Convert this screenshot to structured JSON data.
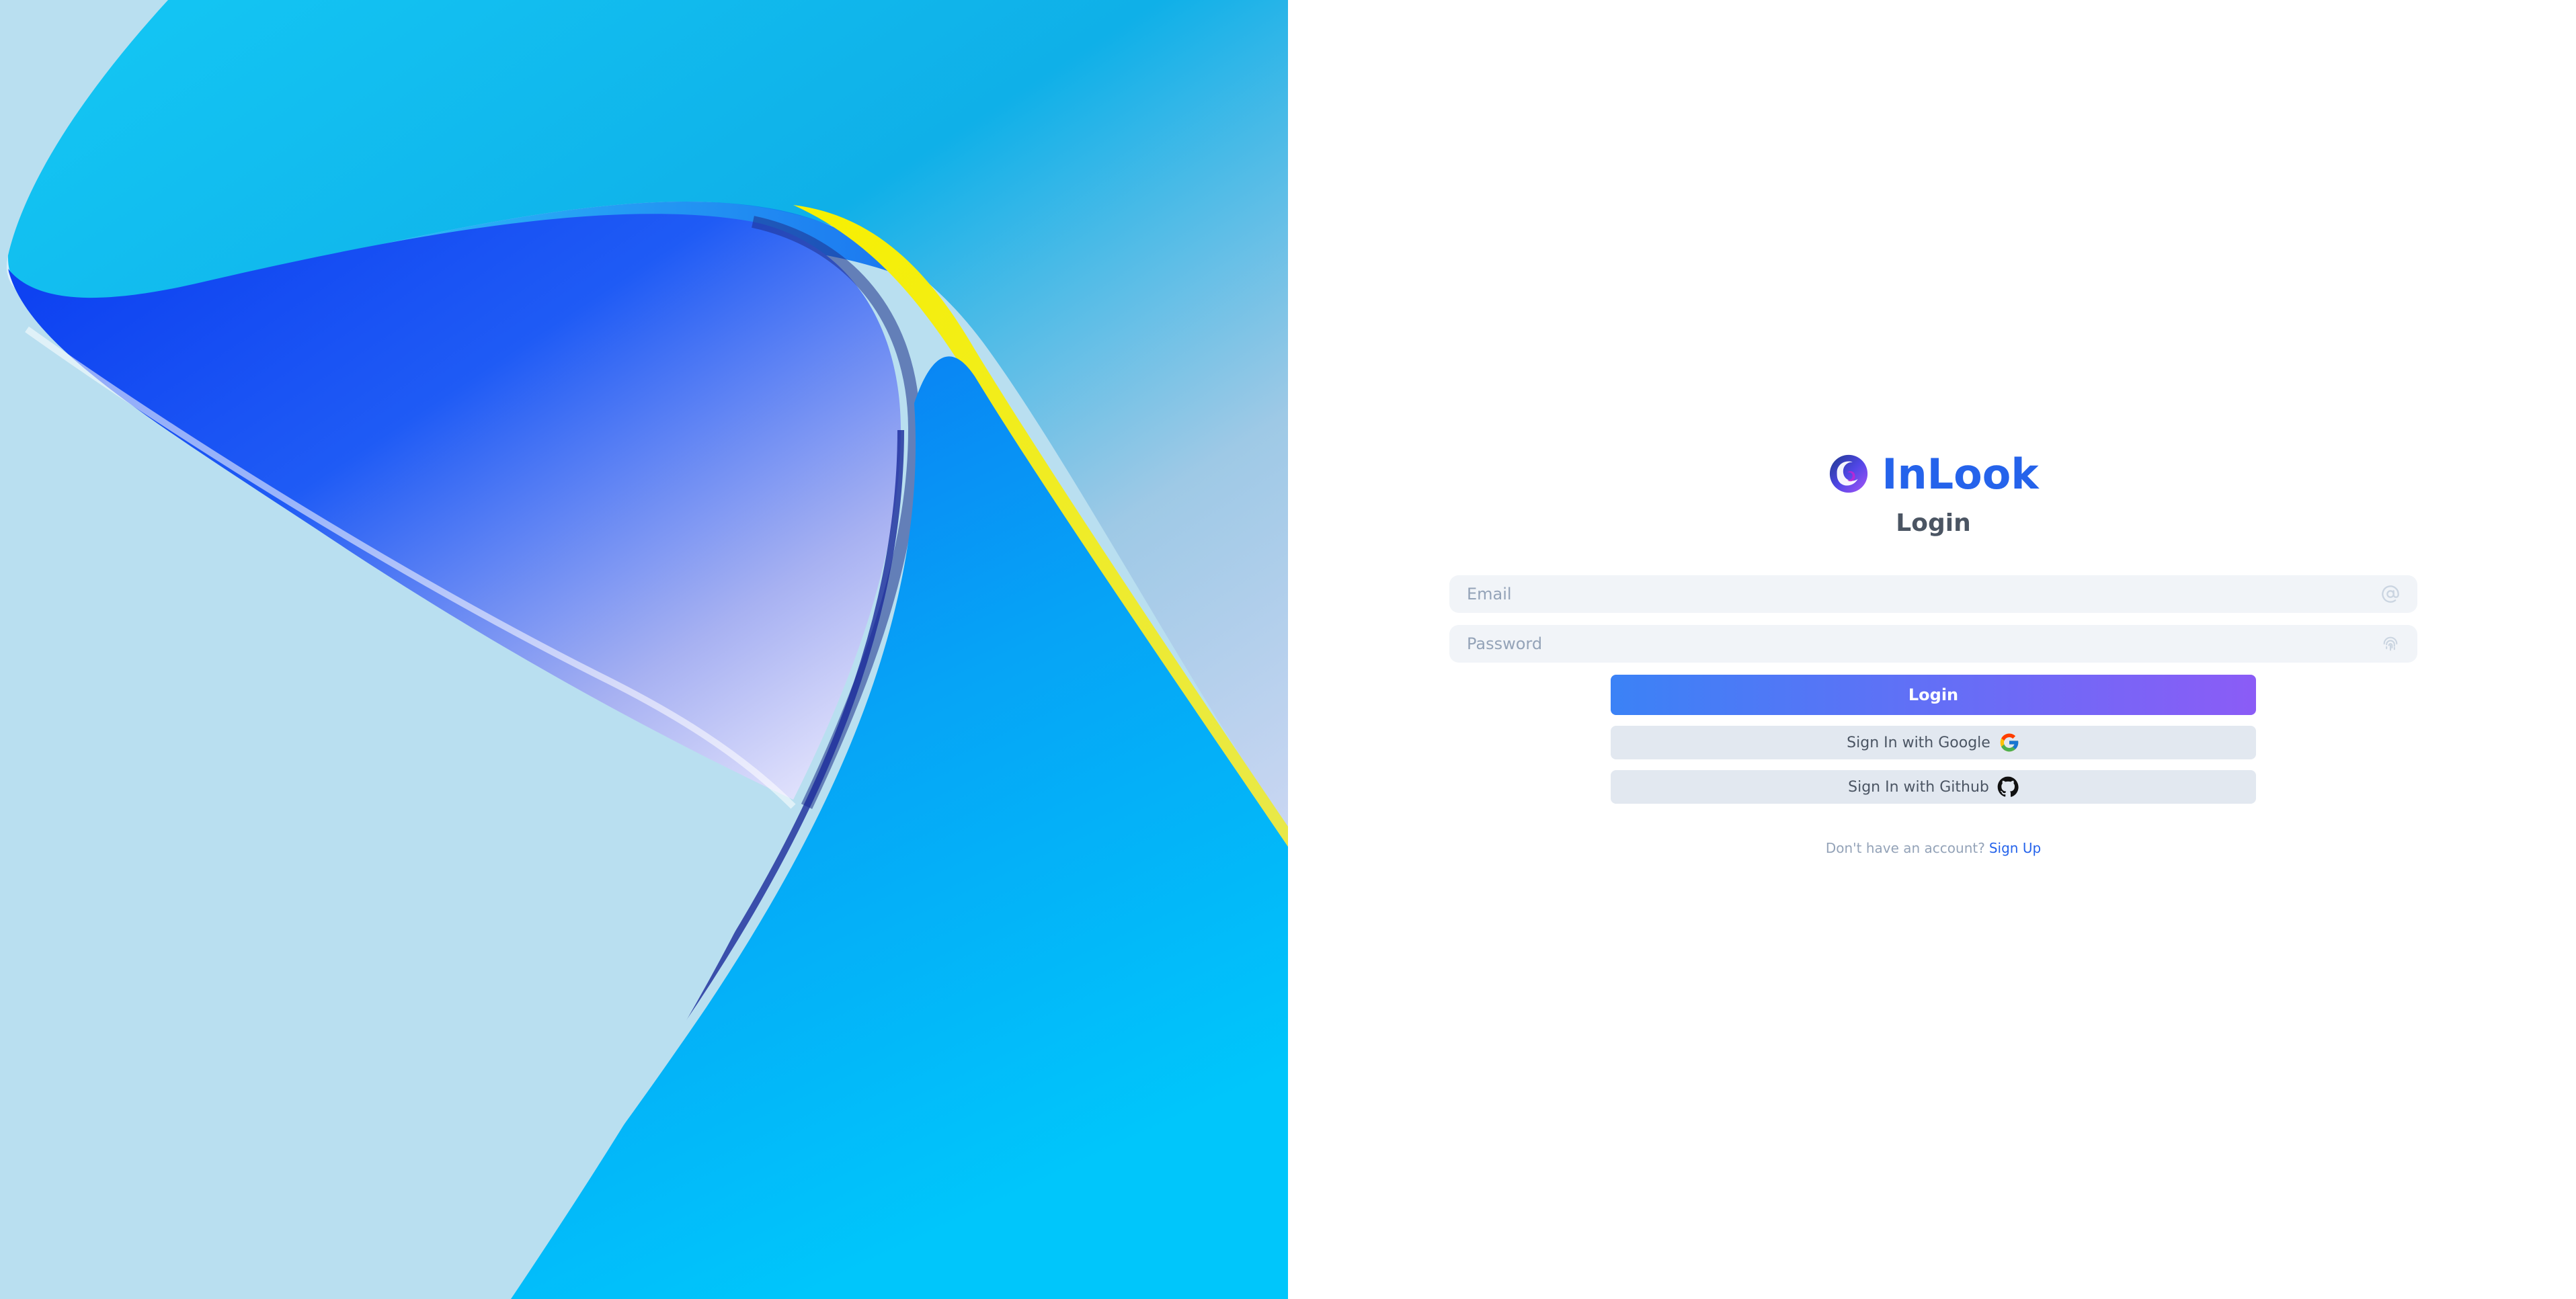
{
  "brand": {
    "name": "InLook",
    "logo_icon": "inlook-swirl-logo-icon"
  },
  "form": {
    "heading": "Login",
    "email_placeholder": "Email",
    "email_icon": "at-sign-icon",
    "password_placeholder": "Password",
    "password_icon": "fingerprint-icon",
    "login_label": "Login",
    "google_label": "Sign In with Google",
    "google_icon": "google-icon",
    "github_label": "Sign In with Github",
    "github_icon": "github-icon"
  },
  "signup": {
    "prompt": "Don't have an account?",
    "link_label": "Sign Up"
  },
  "colors": {
    "brand": "#2563eb",
    "login_gradient_start": "#3b82f6",
    "login_gradient_end": "#8b5cf6",
    "field_background": "#f1f4f8",
    "social_button_background": "#e2e8f0",
    "art_background": "#b9dff0"
  }
}
